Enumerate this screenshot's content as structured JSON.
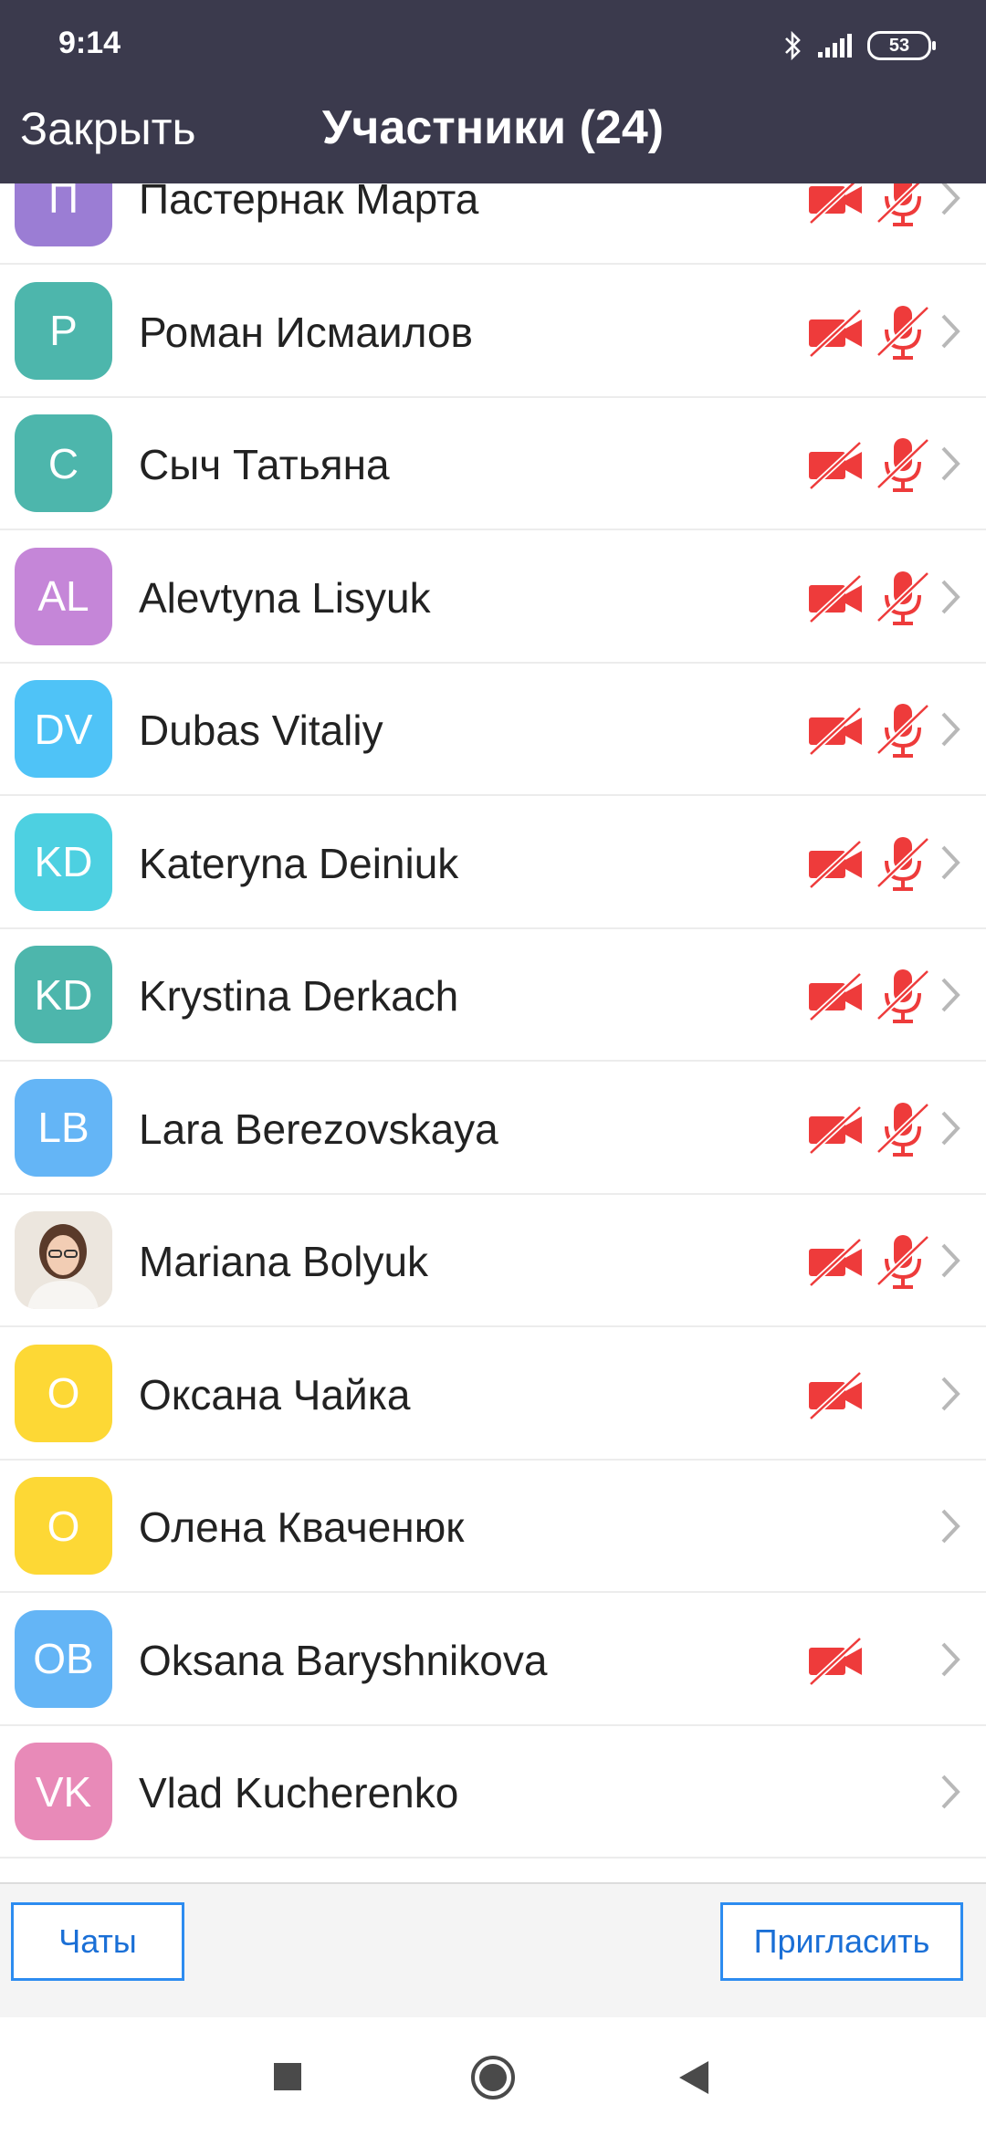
{
  "status_bar": {
    "time": "9:14",
    "battery": "53"
  },
  "header": {
    "close_label": "Закрыть",
    "title": "Участники (24)"
  },
  "participants": [
    {
      "initials": "П",
      "name": "Пастернак Марта",
      "avatar_color": "#9b7dd4",
      "video_off": true,
      "mic_muted": true
    },
    {
      "initials": "Р",
      "name": "Роман Исмаилов",
      "avatar_color": "#4db6ac",
      "video_off": true,
      "mic_muted": true
    },
    {
      "initials": "С",
      "name": "Сыч Татьяна",
      "avatar_color": "#4db6ac",
      "video_off": true,
      "mic_muted": true
    },
    {
      "initials": "AL",
      "name": "Alevtyna Lisyuk",
      "avatar_color": "#c586d8",
      "video_off": true,
      "mic_muted": true
    },
    {
      "initials": "DV",
      "name": "Dubas Vitaliy",
      "avatar_color": "#4fc3f7",
      "video_off": true,
      "mic_muted": true
    },
    {
      "initials": "KD",
      "name": "Kateryna Deiniuk",
      "avatar_color": "#4dd0e1",
      "video_off": true,
      "mic_muted": true
    },
    {
      "initials": "KD",
      "name": "Krystina Derkach",
      "avatar_color": "#4db6ac",
      "video_off": true,
      "mic_muted": true
    },
    {
      "initials": "LB",
      "name": "Lara Berezovskaya",
      "avatar_color": "#64b5f6",
      "video_off": true,
      "mic_muted": true
    },
    {
      "initials": "",
      "name": "Mariana Bolyuk",
      "avatar_color": "#e8e2da",
      "photo": true,
      "video_off": true,
      "mic_muted": true
    },
    {
      "initials": "O",
      "name": "Оксана Чайка",
      "avatar_color": "#fdd835",
      "video_off": true,
      "mic_muted": false
    },
    {
      "initials": "О",
      "name": "Олена Кваченюк",
      "avatar_color": "#fdd835",
      "video_off": false,
      "mic_muted": false
    },
    {
      "initials": "OB",
      "name": "Oksana Baryshnikova",
      "avatar_color": "#64b5f6",
      "video_off": true,
      "mic_muted": false
    },
    {
      "initials": "VK",
      "name": "Vlad Kucherenko",
      "avatar_color": "#e88ab8",
      "video_off": false,
      "mic_muted": false
    }
  ],
  "footer": {
    "chats_label": "Чаты",
    "invite_label": "Пригласить"
  },
  "colors": {
    "header_bg": "#3b3a4d",
    "muted_red": "#ee3b3b",
    "accent_blue": "#1a6fd6"
  }
}
